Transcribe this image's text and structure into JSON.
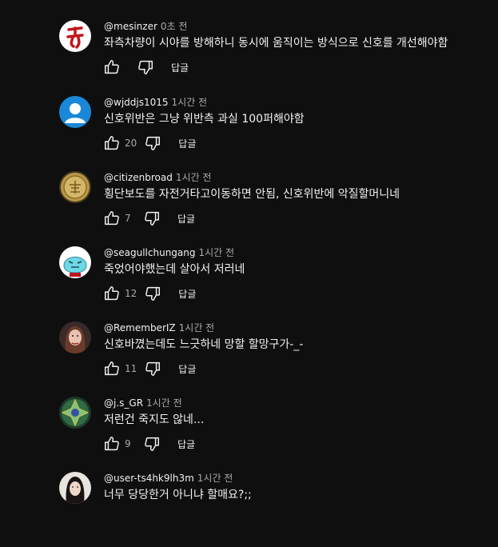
{
  "colors": {
    "background": "#0f0f0f",
    "text_primary": "#f1f1f1",
    "text_secondary": "#aaaaaa"
  },
  "comments": [
    {
      "author": "@mesinzer",
      "time": "0초 전",
      "text": "좌측차량이 시야를 방해하니 동시에 움직이는 방식으로 신호를 개선해야함",
      "likes": "",
      "reply_label": "답글",
      "avatar_icon": "red-brush-character-avatar"
    },
    {
      "author": "@wjddjs1015",
      "time": "1시간 전",
      "text": "신호위반은 그냥 위반측 과실 100퍼해야함",
      "likes": "20",
      "reply_label": "답글",
      "avatar_icon": "default-person-avatar"
    },
    {
      "author": "@citizenbroad",
      "time": "1시간 전",
      "text": "횡단보도를 자전거타고이동하면 안됨, 신호위반에 악질할머니네",
      "likes": "7",
      "reply_label": "답글",
      "avatar_icon": "gold-coin-avatar"
    },
    {
      "author": "@seagullchungang",
      "time": "1시간 전",
      "text": "죽었어야했는데 살아서 저러네",
      "likes": "12",
      "reply_label": "답글",
      "avatar_icon": "cyan-cartoon-avatar"
    },
    {
      "author": "@RememberIZ",
      "time": "1시간 전",
      "text": "신호바꼈는데도 느긋하네 망할 할망구가-_-",
      "likes": "11",
      "reply_label": "답글",
      "avatar_icon": "portrait-photo-avatar"
    },
    {
      "author": "@j.s_GR",
      "time": "1시간 전",
      "text": "저런건 죽지도 않네...",
      "likes": "9",
      "reply_label": "답글",
      "avatar_icon": "green-mandala-avatar"
    },
    {
      "author": "@user-ts4hk9lh3m",
      "time": "1시간 전",
      "text": "너무 당당한거 아니냐 할매요?;;",
      "likes": "",
      "reply_label": "답글",
      "avatar_icon": "portrait-photo-avatar"
    }
  ]
}
